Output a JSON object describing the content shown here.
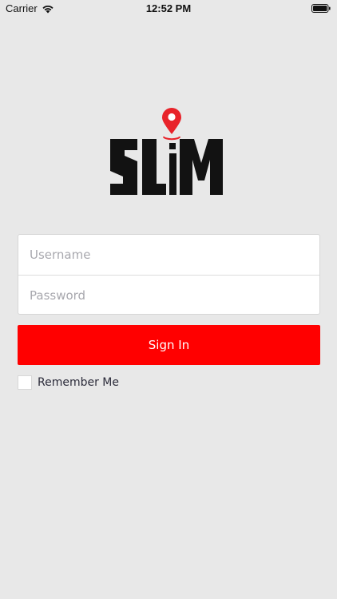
{
  "status_bar": {
    "carrier": "Carrier",
    "time": "12:52 PM",
    "wifi_icon": "wifi-icon",
    "battery_icon": "battery-icon"
  },
  "logo": {
    "text": "SLIM",
    "pin_icon": "map-pin-icon",
    "pin_color": "#e8232a"
  },
  "form": {
    "username_placeholder": "Username",
    "username_value": "",
    "password_placeholder": "Password",
    "password_value": "",
    "sign_in_label": "Sign In",
    "remember_label": "Remember Me",
    "remember_checked": false
  },
  "colors": {
    "background": "#e8e8e8",
    "accent": "#ff0000"
  }
}
